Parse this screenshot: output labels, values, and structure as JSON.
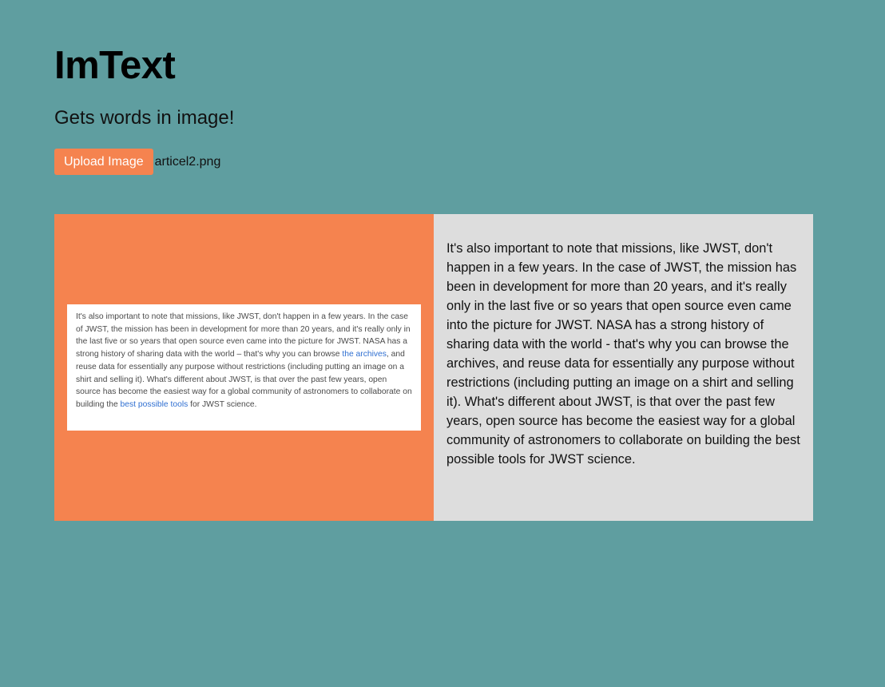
{
  "app": {
    "title": "ImText",
    "subtitle": "Gets words in image!"
  },
  "upload": {
    "button_label": "Upload Image",
    "file_name": "articel2.png"
  },
  "image_preview": {
    "text_part1": "It's also important to note that missions, like JWST, don't happen in a few years. In the case of JWST, the mission has been in development for more than 20 years, and it's really only in the last five or so years that open source even came into the picture for JWST. NASA has a strong history of sharing data with the world – that's why you can browse ",
    "link1": "the archives",
    "text_part2": ", and reuse data for essentially any purpose without restrictions (including putting an image on a shirt and selling it). What's different about JWST, is that over the past few years, open source has become the easiest way for a global community of astronomers to collaborate on building the ",
    "link2": "best possible tools",
    "text_part3": " for JWST science."
  },
  "result": {
    "extracted_text": "It's also important to note that missions, like JWST, don't happen in a few years. In the case of JWST, the mission has been in development for more than 20 years, and it's really only in the last five or so years that open source even came into the picture for JWST. NASA has a strong history of sharing data with the world - that's why you can browse the archives, and reuse data for essentially any purpose without restrictions (including putting an image on a shirt and selling it). What's different about JWST, is that over the past few years, open source has become the easiest way for a global community of astronomers to collaborate on building the best possible tools for JWST science."
  },
  "colors": {
    "background": "#5f9ea0",
    "accent": "#f5834f",
    "result_panel": "#dddddd",
    "link": "#2f6fd1"
  }
}
